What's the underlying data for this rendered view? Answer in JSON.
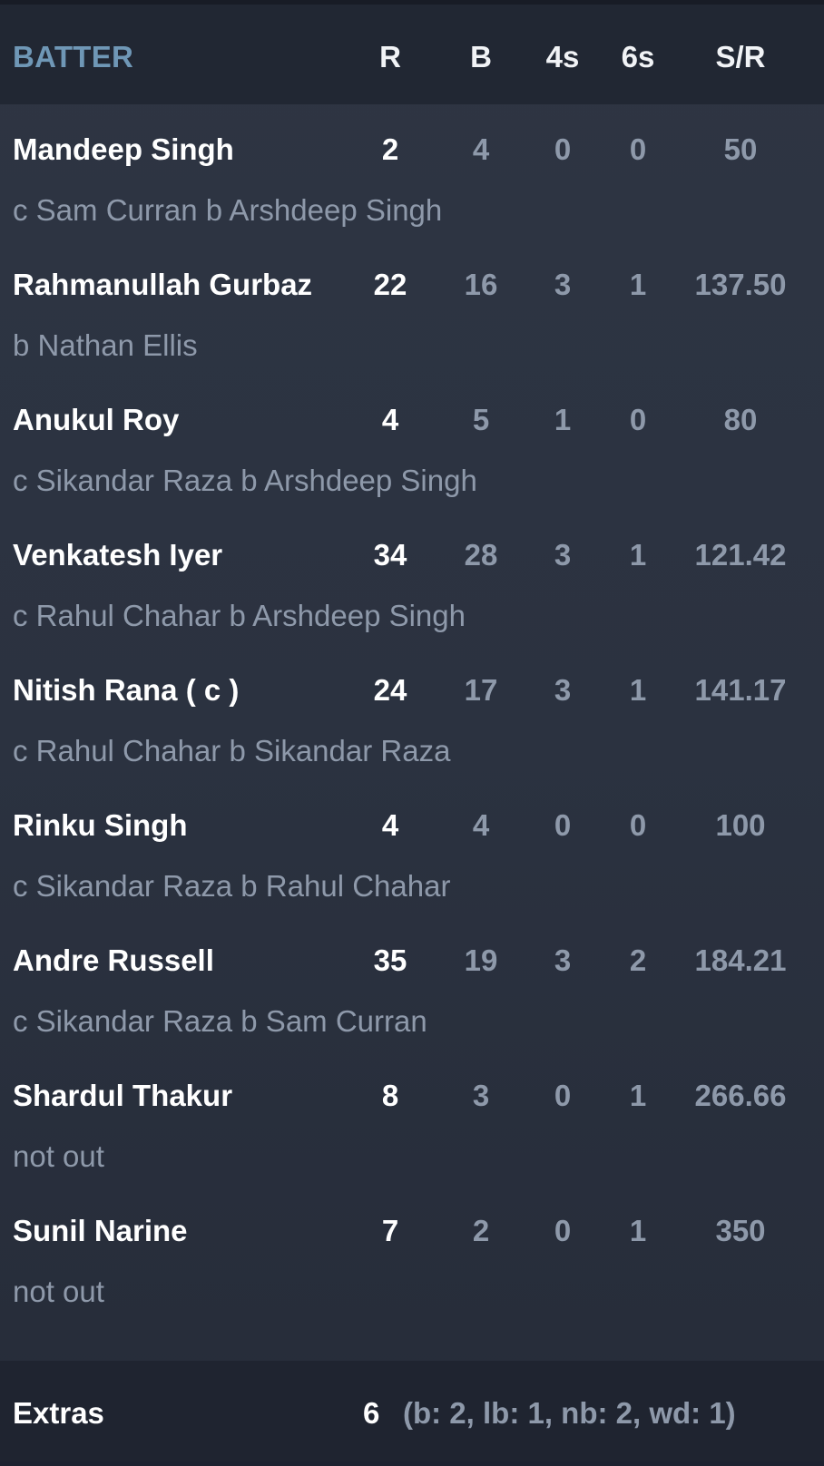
{
  "header": {
    "batter": "BATTER",
    "runs": "R",
    "balls": "B",
    "fours": "4s",
    "sixes": "6s",
    "strike_rate": "S/R"
  },
  "batters": [
    {
      "name": "Mandeep Singh",
      "dismissal": "c Sam Curran b Arshdeep Singh",
      "r": "2",
      "b": "4",
      "fours": "0",
      "sixes": "0",
      "sr": "50"
    },
    {
      "name": "Rahmanullah Gurbaz",
      "dismissal": "b Nathan Ellis",
      "r": "22",
      "b": "16",
      "fours": "3",
      "sixes": "1",
      "sr": "137.50"
    },
    {
      "name": "Anukul Roy",
      "dismissal": "c Sikandar Raza b Arshdeep Singh",
      "r": "4",
      "b": "5",
      "fours": "1",
      "sixes": "0",
      "sr": "80"
    },
    {
      "name": "Venkatesh Iyer",
      "dismissal": "c Rahul Chahar b Arshdeep Singh",
      "r": "34",
      "b": "28",
      "fours": "3",
      "sixes": "1",
      "sr": "121.42"
    },
    {
      "name": "Nitish Rana ( c )",
      "dismissal": "c Rahul Chahar b Sikandar Raza",
      "r": "24",
      "b": "17",
      "fours": "3",
      "sixes": "1",
      "sr": "141.17"
    },
    {
      "name": "Rinku Singh",
      "dismissal": "c Sikandar Raza b Rahul Chahar",
      "r": "4",
      "b": "4",
      "fours": "0",
      "sixes": "0",
      "sr": "100"
    },
    {
      "name": "Andre Russell",
      "dismissal": "c Sikandar Raza b Sam Curran",
      "r": "35",
      "b": "19",
      "fours": "3",
      "sixes": "2",
      "sr": "184.21"
    },
    {
      "name": "Shardul Thakur",
      "dismissal": "not out",
      "r": "8",
      "b": "3",
      "fours": "0",
      "sixes": "1",
      "sr": "266.66"
    },
    {
      "name": "Sunil Narine",
      "dismissal": "not out",
      "r": "7",
      "b": "2",
      "fours": "0",
      "sixes": "1",
      "sr": "350"
    }
  ],
  "extras": {
    "label": "Extras",
    "total": "6",
    "detail": "(b: 2, lb: 1, nb: 2, wd: 1)"
  },
  "colors": {
    "batter_header": "#6f97b6",
    "primary_text": "#ffffff",
    "secondary_text": "#8e99aa",
    "header_bg": "#212733",
    "row_bg": "#2b3240"
  }
}
